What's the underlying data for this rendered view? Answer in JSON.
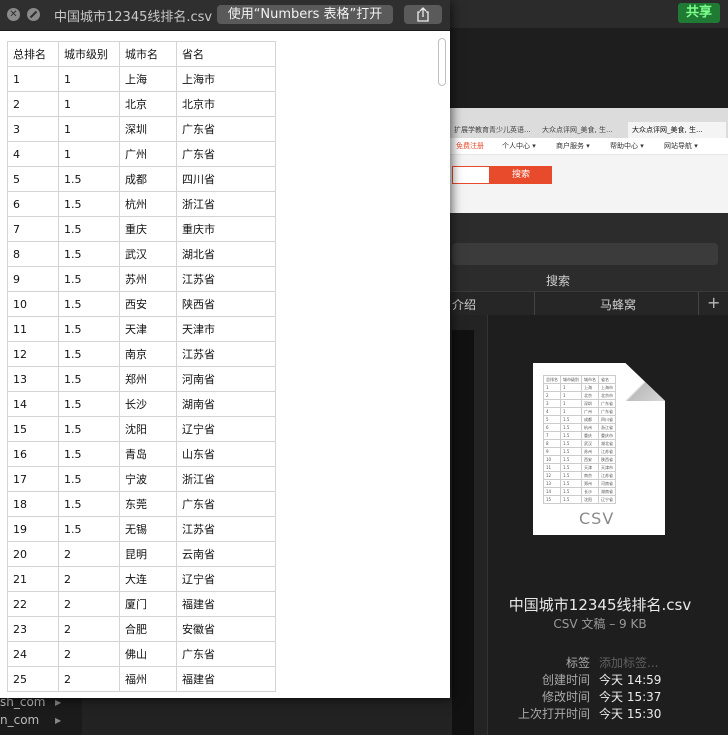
{
  "quicklook": {
    "title": "中国城市12345线排名.csv",
    "open_button": "使用“Numbers 表格”打开",
    "icons": {
      "close": "close-icon",
      "fullscreen": "fullscreen-icon",
      "share": "share-icon"
    },
    "columns": [
      "总排名",
      "城市级别",
      "城市名",
      "省名"
    ],
    "rows": [
      [
        "1",
        "1",
        "上海",
        "上海市"
      ],
      [
        "2",
        "1",
        "北京",
        "北京市"
      ],
      [
        "3",
        "1",
        "深圳",
        "广东省"
      ],
      [
        "4",
        "1",
        "广州",
        "广东省"
      ],
      [
        "5",
        "1.5",
        "成都",
        "四川省"
      ],
      [
        "6",
        "1.5",
        "杭州",
        "浙江省"
      ],
      [
        "7",
        "1.5",
        "重庆",
        "重庆市"
      ],
      [
        "8",
        "1.5",
        "武汉",
        "湖北省"
      ],
      [
        "9",
        "1.5",
        "苏州",
        "江苏省"
      ],
      [
        "10",
        "1.5",
        "西安",
        "陕西省"
      ],
      [
        "11",
        "1.5",
        "天津",
        "天津市"
      ],
      [
        "12",
        "1.5",
        "南京",
        "江苏省"
      ],
      [
        "13",
        "1.5",
        "郑州",
        "河南省"
      ],
      [
        "14",
        "1.5",
        "长沙",
        "湖南省"
      ],
      [
        "15",
        "1.5",
        "沈阳",
        "辽宁省"
      ],
      [
        "16",
        "1.5",
        "青岛",
        "山东省"
      ],
      [
        "17",
        "1.5",
        "宁波",
        "浙江省"
      ],
      [
        "18",
        "1.5",
        "东莞",
        "广东省"
      ],
      [
        "19",
        "1.5",
        "无锡",
        "江苏省"
      ],
      [
        "20",
        "2",
        "昆明",
        "云南省"
      ],
      [
        "21",
        "2",
        "大连",
        "辽宁省"
      ],
      [
        "22",
        "2",
        "厦门",
        "福建省"
      ],
      [
        "23",
        "2",
        "合肥",
        "安徽省"
      ],
      [
        "24",
        "2",
        "佛山",
        "广东省"
      ],
      [
        "25",
        "2",
        "福州",
        "福建省"
      ]
    ]
  },
  "background": {
    "share_button": "共享",
    "browser_tabs": [
      "扩展学教育青少儿英语...",
      "大众点评网_美食, 生...",
      "大众点评网_美食, 生..."
    ],
    "browser_nav": [
      "免费注册",
      "个人中心 ▾",
      "商户服务 ▾",
      "帮助中心 ▾",
      "网站导航 ▾"
    ],
    "browser_search_button": "搜索",
    "search_label": "搜索",
    "tabs": [
      "介绍",
      "马蜂窝"
    ],
    "sidebar_items": [
      "sh_com",
      "n_com"
    ]
  },
  "file_info": {
    "name": "中国城市12345线排名.csv",
    "kind_size": "CSV 文稿 – 9 KB",
    "thumb_label": "CSV",
    "meta": [
      {
        "label": "标签",
        "value": "添加标签..."
      },
      {
        "label": "创建时间",
        "value": "今天 14:59"
      },
      {
        "label": "修改时间",
        "value": "今天 15:37"
      },
      {
        "label": "上次打开时间",
        "value": "今天 15:30"
      }
    ]
  },
  "colors": {
    "share_green": "#1f7a33",
    "browser_red": "#e84b2b"
  }
}
